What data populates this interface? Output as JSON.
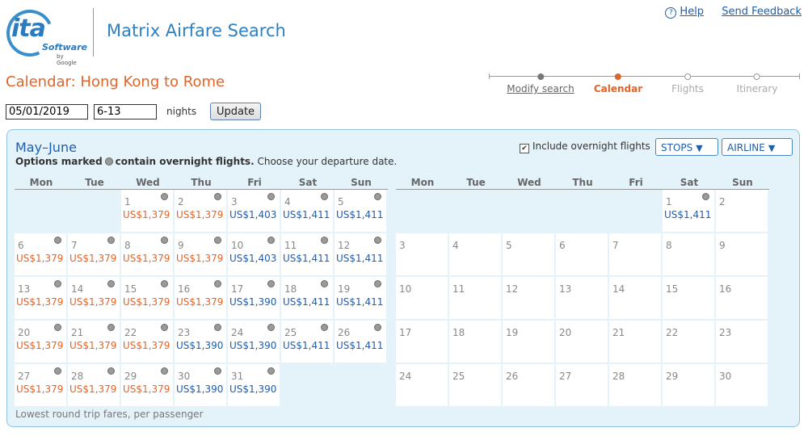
{
  "logo": {
    "text": "ita",
    "software": "Software",
    "by": "by Google"
  },
  "app_title": "Matrix Airfare Search",
  "links": {
    "help": "Help",
    "feedback": "Send Feedback"
  },
  "page_title": "Calendar: Hong Kong to Rome",
  "steps": [
    {
      "label": "Modify search",
      "state": "done"
    },
    {
      "label": "Calendar",
      "state": "active"
    },
    {
      "label": "Flights",
      "state": "future"
    },
    {
      "label": "Itinerary",
      "state": "future"
    }
  ],
  "form": {
    "date": "05/01/2019",
    "nights": "6-13",
    "nights_label": "nights",
    "update": "Update"
  },
  "panel": {
    "month_title": "May–June",
    "subtitle_bold": "Options marked",
    "subtitle_bold2": "contain overnight flights.",
    "subtitle_rest": "Choose your departure date.",
    "include_overnight": "Include overnight flights",
    "include_checked": true,
    "stops": "STOPS",
    "airline": "AIRLINE",
    "footnote": "Lowest round trip fares, per passenger"
  },
  "weekdays": [
    "Mon",
    "Tue",
    "Wed",
    "Thu",
    "Fri",
    "Sat",
    "Sun"
  ],
  "colors": {
    "orange": "#e0652a",
    "blue": "#1f5ea8"
  },
  "may": [
    null,
    null,
    {
      "day": "1",
      "fare": "US$1,379",
      "color": "orange",
      "overnight": true
    },
    {
      "day": "2",
      "fare": "US$1,379",
      "color": "orange",
      "overnight": true
    },
    {
      "day": "3",
      "fare": "US$1,403",
      "color": "blue",
      "overnight": true
    },
    {
      "day": "4",
      "fare": "US$1,411",
      "color": "blue",
      "overnight": true
    },
    {
      "day": "5",
      "fare": "US$1,411",
      "color": "blue",
      "overnight": true
    },
    {
      "day": "6",
      "fare": "US$1,379",
      "color": "orange",
      "overnight": true
    },
    {
      "day": "7",
      "fare": "US$1,379",
      "color": "orange",
      "overnight": true
    },
    {
      "day": "8",
      "fare": "US$1,379",
      "color": "orange",
      "overnight": true
    },
    {
      "day": "9",
      "fare": "US$1,379",
      "color": "orange",
      "overnight": true
    },
    {
      "day": "10",
      "fare": "US$1,403",
      "color": "blue",
      "overnight": true
    },
    {
      "day": "11",
      "fare": "US$1,411",
      "color": "blue",
      "overnight": true
    },
    {
      "day": "12",
      "fare": "US$1,411",
      "color": "blue",
      "overnight": true
    },
    {
      "day": "13",
      "fare": "US$1,379",
      "color": "orange",
      "overnight": true
    },
    {
      "day": "14",
      "fare": "US$1,379",
      "color": "orange",
      "overnight": true
    },
    {
      "day": "15",
      "fare": "US$1,379",
      "color": "orange",
      "overnight": true
    },
    {
      "day": "16",
      "fare": "US$1,379",
      "color": "orange",
      "overnight": true
    },
    {
      "day": "17",
      "fare": "US$1,390",
      "color": "blue",
      "overnight": true
    },
    {
      "day": "18",
      "fare": "US$1,411",
      "color": "blue",
      "overnight": true
    },
    {
      "day": "19",
      "fare": "US$1,411",
      "color": "blue",
      "overnight": true
    },
    {
      "day": "20",
      "fare": "US$1,379",
      "color": "orange",
      "overnight": true
    },
    {
      "day": "21",
      "fare": "US$1,379",
      "color": "orange",
      "overnight": true
    },
    {
      "day": "22",
      "fare": "US$1,379",
      "color": "orange",
      "overnight": true
    },
    {
      "day": "23",
      "fare": "US$1,390",
      "color": "blue",
      "overnight": true
    },
    {
      "day": "24",
      "fare": "US$1,390",
      "color": "blue",
      "overnight": true
    },
    {
      "day": "25",
      "fare": "US$1,411",
      "color": "blue",
      "overnight": true
    },
    {
      "day": "26",
      "fare": "US$1,411",
      "color": "blue",
      "overnight": true
    },
    {
      "day": "27",
      "fare": "US$1,379",
      "color": "orange",
      "overnight": true
    },
    {
      "day": "28",
      "fare": "US$1,379",
      "color": "orange",
      "overnight": true
    },
    {
      "day": "29",
      "fare": "US$1,379",
      "color": "orange",
      "overnight": true
    },
    {
      "day": "30",
      "fare": "US$1,390",
      "color": "blue",
      "overnight": true
    },
    {
      "day": "31",
      "fare": "US$1,390",
      "color": "blue",
      "overnight": true
    }
  ],
  "june": [
    null,
    null,
    null,
    null,
    null,
    {
      "day": "1",
      "fare": "US$1,411",
      "color": "blue",
      "overnight": true
    },
    {
      "day": "2"
    },
    {
      "day": "3"
    },
    {
      "day": "4"
    },
    {
      "day": "5"
    },
    {
      "day": "6"
    },
    {
      "day": "7"
    },
    {
      "day": "8"
    },
    {
      "day": "9"
    },
    {
      "day": "10"
    },
    {
      "day": "11"
    },
    {
      "day": "12"
    },
    {
      "day": "13"
    },
    {
      "day": "14"
    },
    {
      "day": "15"
    },
    {
      "day": "16"
    },
    {
      "day": "17"
    },
    {
      "day": "18"
    },
    {
      "day": "19"
    },
    {
      "day": "20"
    },
    {
      "day": "21"
    },
    {
      "day": "22"
    },
    {
      "day": "23"
    },
    {
      "day": "24"
    },
    {
      "day": "25"
    },
    {
      "day": "26"
    },
    {
      "day": "27"
    },
    {
      "day": "28"
    },
    {
      "day": "29"
    },
    {
      "day": "30"
    }
  ]
}
